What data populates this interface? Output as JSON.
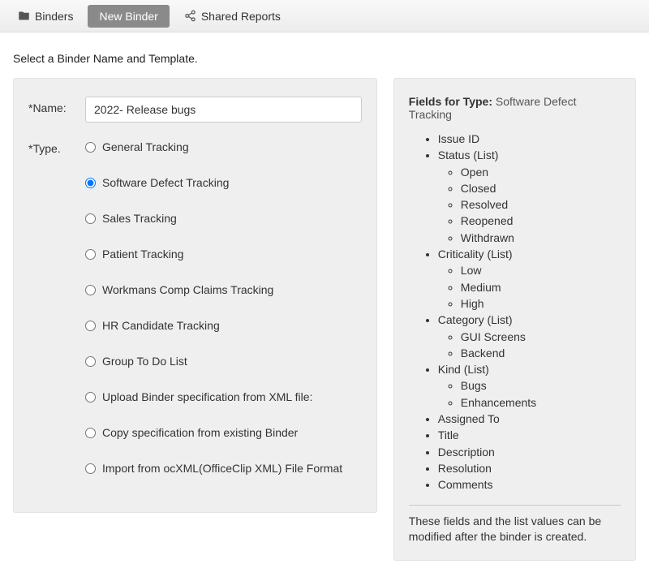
{
  "tabs": {
    "binders": "Binders",
    "new_binder": "New Binder",
    "shared_reports": "Shared Reports"
  },
  "page_title": "Select a Binder Name and Template.",
  "form": {
    "name_label": "*Name:",
    "name_value": "2022- Release bugs",
    "type_label": "*Type.",
    "type_options": [
      "General Tracking",
      "Software Defect Tracking",
      "Sales Tracking",
      "Patient Tracking",
      "Workmans Comp Claims Tracking",
      "HR Candidate Tracking",
      "Group To Do List",
      "Upload Binder specification from XML file:",
      "Copy specification from existing Binder",
      "Import from ocXML(OfficeClip XML) File Format"
    ],
    "selected_type_index": 1
  },
  "fields_panel": {
    "header_label": "Fields for Type:",
    "header_type": "Software Defect Tracking",
    "fields": [
      {
        "name": "Issue ID"
      },
      {
        "name": "Status (List)",
        "children": [
          "Open",
          "Closed",
          "Resolved",
          "Reopened",
          "Withdrawn"
        ]
      },
      {
        "name": "Criticality (List)",
        "children": [
          "Low",
          "Medium",
          "High"
        ]
      },
      {
        "name": "Category (List)",
        "children": [
          "GUI Screens",
          "Backend"
        ]
      },
      {
        "name": "Kind (List)",
        "children": [
          "Bugs",
          "Enhancements"
        ]
      },
      {
        "name": "Assigned To"
      },
      {
        "name": "Title"
      },
      {
        "name": "Description"
      },
      {
        "name": "Resolution"
      },
      {
        "name": "Comments"
      }
    ],
    "note": "These fields and the list values can be modified after the binder is created."
  }
}
